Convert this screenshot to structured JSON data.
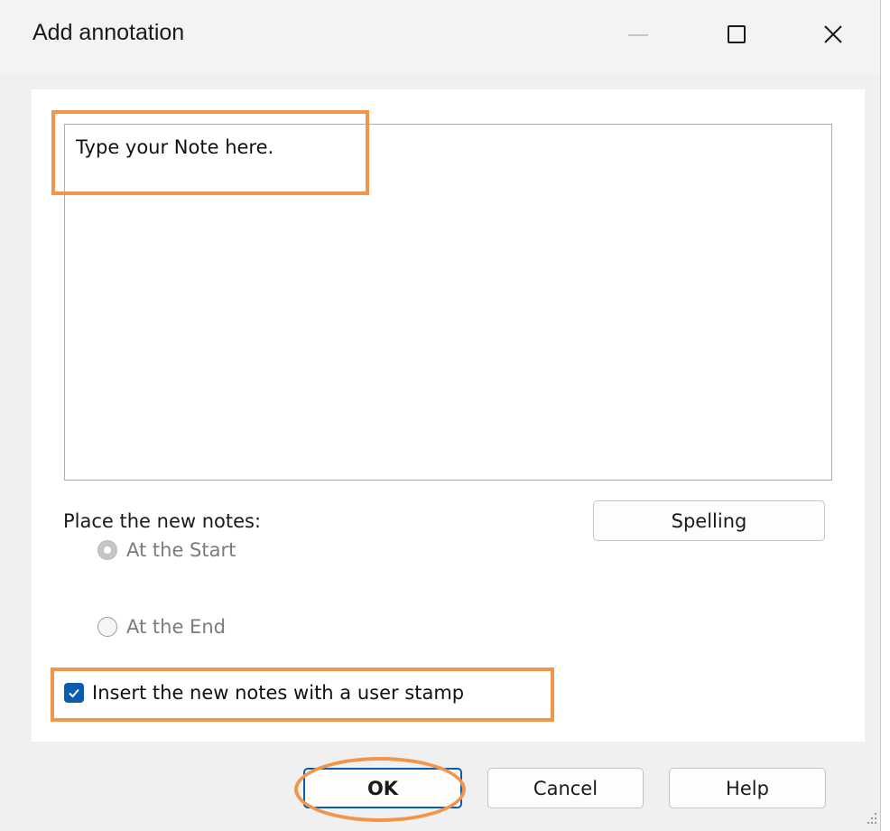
{
  "window": {
    "title": "Add annotation"
  },
  "titlebar": {
    "minimize_icon": "minimize-icon",
    "maximize_icon": "maximize-icon",
    "close_icon": "close-icon"
  },
  "note": {
    "text": "Type your Note here."
  },
  "placement": {
    "label": "Place the new notes:",
    "options": [
      {
        "label": "At the Start",
        "selected": true,
        "enabled": false
      },
      {
        "label": "At the End",
        "selected": false,
        "enabled": false
      }
    ]
  },
  "spelling_label": "Spelling",
  "stamp": {
    "label": "Insert the new notes with a user stamp",
    "checked": true
  },
  "buttons": {
    "ok": "OK",
    "cancel": "Cancel",
    "help": "Help"
  },
  "colors": {
    "accent": "#0b5cad",
    "highlight": "#f0954a",
    "disabled_text": "#7b7b7b"
  }
}
